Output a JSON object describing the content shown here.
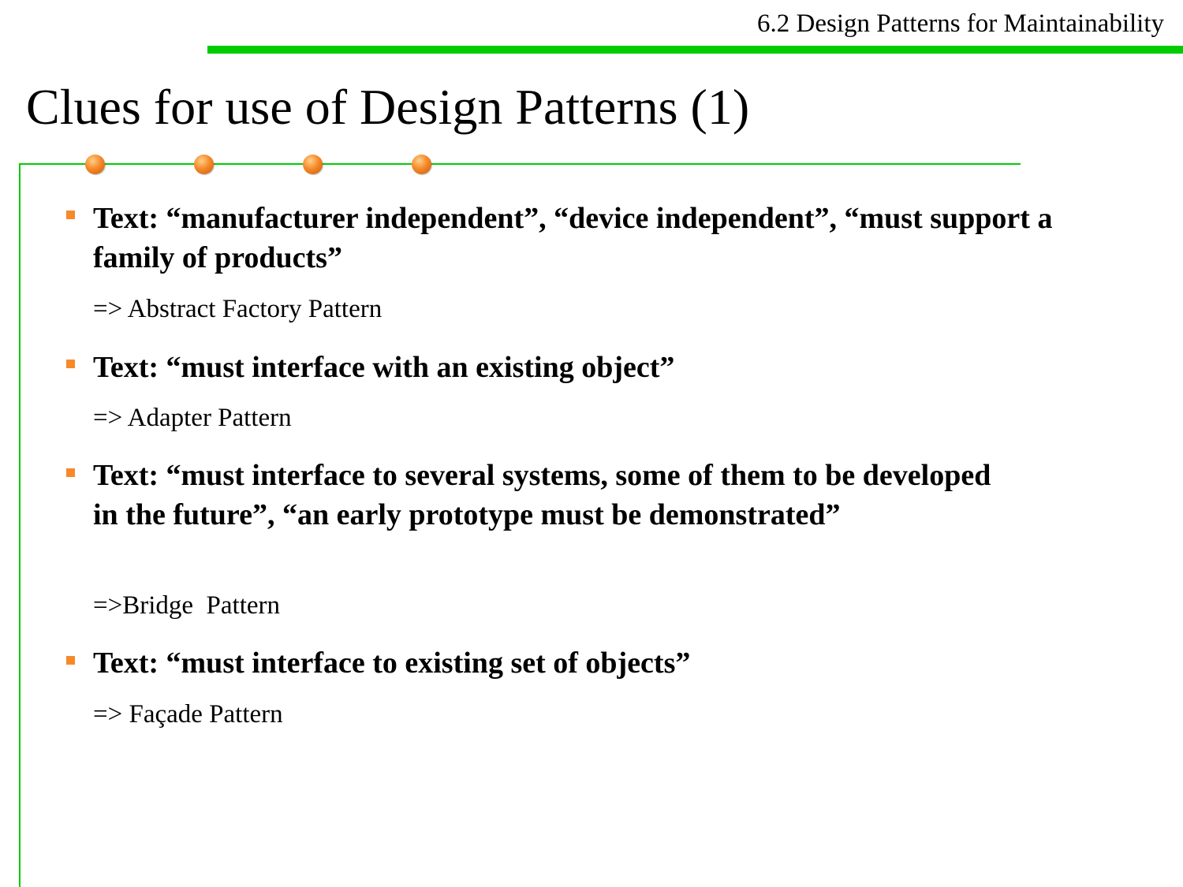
{
  "header": {
    "section_label": "6.2 Design Patterns for Maintainability"
  },
  "title": "Clues for use of Design Patterns (1)",
  "colors": {
    "accent_green": "#00cc00",
    "bullet_orange": "#f7892a"
  },
  "items": [
    {
      "text": "Text: “manufacturer independent”, “device independent”,  “must support a family of products”",
      "answer": "=> Abstract Factory Pattern"
    },
    {
      "text": "Text: “must interface with an existing object”",
      "answer": "=> Adapter Pattern"
    },
    {
      "text": "Text: “must interface to several systems, some of them to be developed in the future”, “an early prototype must be demonstrated”",
      "answer": "=>Bridge  Pattern"
    },
    {
      "text": "Text:  “must interface to existing set of objects”",
      "answer": "=> Façade Pattern"
    }
  ]
}
